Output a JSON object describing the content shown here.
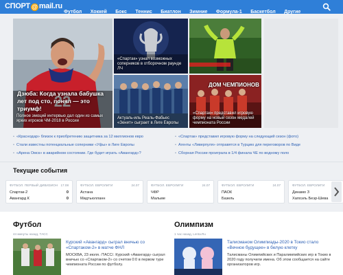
{
  "header": {
    "logo_prefix": "СПОРТ",
    "logo_at": "@",
    "logo_suffix": "mail.ru",
    "nav": [
      "Футбол",
      "Хоккей",
      "Бокс",
      "Теннис",
      "Биатлон",
      "Зимние",
      "Формула-1",
      "Баскетбол",
      "Другие"
    ],
    "search_icon": "search-icon"
  },
  "hero": {
    "big": {
      "title": "Дзюба: Когда узнала бабушка лет под сто, понял — это триумф!",
      "caption": "Полное эмоций интервью дал один из самых ярких игроков ЧМ-2018 в России"
    },
    "t2": "«Спартак» узнал возможных соперников в отборочном раунде ЛЧ",
    "t3": "",
    "t4": "Актуаль-иль Реаль-Фабьес «Зенит» сыграет в Лиге Европы",
    "t5": "«Спартак» представил игровую форму на новый сезон медалей чемпионата России",
    "big_tile_label": "ДОМ ЧЕМПИОНОВ"
  },
  "links": {
    "left": [
      "«Краснодар» близок к приобретению защитника за 12 миллионов евро",
      "Стали известны потенциальные соперники «Уфы» в Лиге Европы",
      "«Арена Омск» в аварийном состоянии. Где будет играть «Авангард»?"
    ],
    "right": [
      "«Спартак» представил игровую форму на следующий сезон (фото)",
      "Агенты «Ливерпуля» отправятся в Турцию для переговоров по Виде",
      "Сборная России проиграла в 1/4 финала ЧЕ по водному поло"
    ]
  },
  "events": {
    "title": "Текущие события",
    "cards": [
      {
        "league": "Футбол. Первый дивизион",
        "date": "17.08",
        "team1": "Спартак-2",
        "score1": "0",
        "team2": "Авангард К",
        "score2": "0"
      },
      {
        "league": "Футбол. Евролиги",
        "date": "24.07",
        "team1": "Астана",
        "score1": "",
        "team2": "Мидтьюлланн",
        "score2": ""
      },
      {
        "league": "Футбол. Евролиги",
        "date": "24.07",
        "team1": "ЧФР",
        "score1": "",
        "team2": "Мальме",
        "score2": ""
      },
      {
        "league": "Футбол. Евролиги",
        "date": "24.07",
        "team1": "ПАОК",
        "score1": "",
        "team2": "Базель",
        "score2": ""
      },
      {
        "league": "Футбол. Евролиги",
        "date": "24.07",
        "team1": "Динамо З",
        "score1": "",
        "team2": "Хапоэль Беэр-Шева",
        "score2": ""
      }
    ],
    "next_icon": "chevron-right-icon"
  },
  "football": {
    "title": "Футбол",
    "meta": "44 минуты назад, ТАСС",
    "headline": "Курский «Авангард» сыграл вничью со «Спартаком-2» в матче ФНЛ",
    "body": "МОСКВА, 23 июля. /ТАСС/. Курский «Авангард» сыграл вничью со «Спартаком-2» со счетом 0:0 в первом туре чемпионата России по футболу."
  },
  "olympism": {
    "title": "Олимпизм",
    "meta": "1 час назад, Lenta.Ru",
    "headline": "Талисманом Олимпиады-2020 в Токио стало «Вечное будущее» в белую клетку",
    "body": "Талисманы Олимпийских и Паралимпийских игр в Токио в 2020 году получили имена. Об этом сообщается на сайте организаторов игр."
  }
}
